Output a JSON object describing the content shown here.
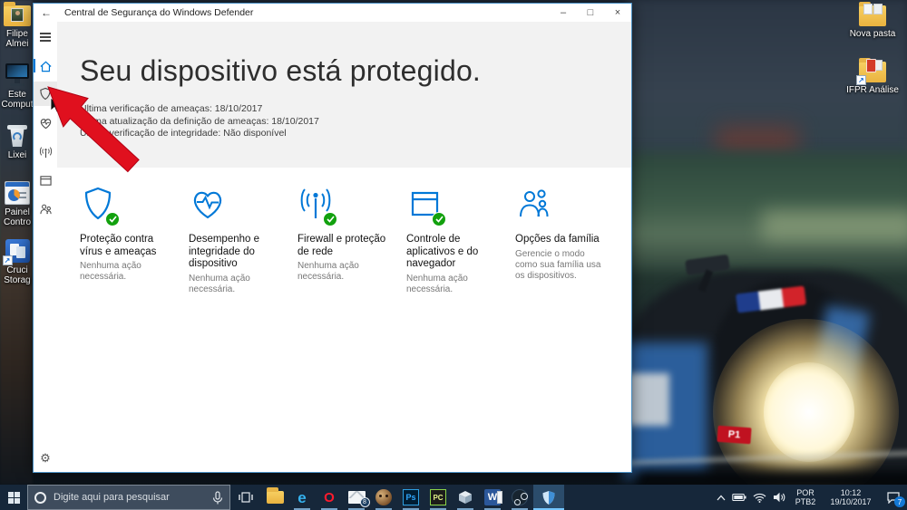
{
  "wallpaper": {
    "p1_badge": "P1"
  },
  "window": {
    "title": "Central de Segurança do Windows Defender",
    "controls": {
      "back": "←",
      "minimize": "–",
      "maximize": "□",
      "close": "×"
    },
    "heading": "Seu dispositivo está protegido.",
    "status_lines": [
      "Última verificação de ameaças: 18/10/2017",
      "Última atualização da definição de ameaças: 18/10/2017",
      "Última verificação de integridade: Não disponível"
    ],
    "tiles": [
      {
        "icon": "virus-shield-icon",
        "title": "Proteção contra vírus e ameaças",
        "subtitle": "Nenhuma ação necessária."
      },
      {
        "icon": "device-health-icon",
        "title": "Desempenho e integridade do dispositivo",
        "subtitle": "Nenhuma ação necessária."
      },
      {
        "icon": "firewall-network-icon",
        "title": "Firewall e proteção de rede",
        "subtitle": "Nenhuma ação necessária."
      },
      {
        "icon": "app-browser-icon",
        "title": "Controle de aplicativos e do navegador",
        "subtitle": "Nenhuma ação necessária."
      },
      {
        "icon": "family-icon",
        "title": "Opções da família",
        "subtitle": "Gerencie o modo como sua família usa os dispositivos."
      }
    ],
    "settings_gear": "⚙",
    "sidebar_icon_names": [
      "menu-icon",
      "home-icon",
      "shield-icon",
      "device-health-icon",
      "wireless-icon",
      "app-browser-icon",
      "family-icon",
      "settings-gear-icon"
    ]
  },
  "desktop": {
    "left_icons": [
      {
        "name": "user-files-folder",
        "line1": "Filipe",
        "line2": "Almei"
      },
      {
        "name": "this-pc",
        "line1": "Este",
        "line2": "Comput"
      },
      {
        "name": "recycle-bin",
        "line1": "Lixei",
        "line2": ""
      },
      {
        "name": "control-panel",
        "line1": "Painel",
        "line2": "Contro"
      },
      {
        "name": "crucial-storage",
        "line1": "Cruci",
        "line2": "Storag"
      }
    ],
    "right_icons": [
      {
        "name": "new-folder",
        "label": "Nova pasta"
      },
      {
        "name": "ifpr-analysis-folder",
        "label": "IFPR Análise"
      }
    ]
  },
  "taskbar": {
    "search_placeholder": "Digite aqui para pesquisar",
    "glyphs": {
      "edge": "e",
      "opera": "O",
      "photoshop": "Ps",
      "pycharm": "PC",
      "word": "W"
    },
    "mail_badge": "8",
    "tray": {
      "language_line1": "POR",
      "language_line2": "PTB2",
      "time": "10:12",
      "date": "19/10/2017",
      "notification_badge": "7"
    }
  },
  "colors": {
    "accent": "#0078d7",
    "ok_green": "#12a10e",
    "arrow_red": "#e0101e"
  }
}
